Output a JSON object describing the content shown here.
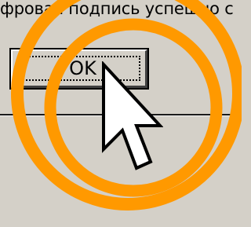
{
  "dialog": {
    "message": "фровая подпись успешно с",
    "ok_label": "OK"
  },
  "overlay": {
    "highlight_color": "#ff9900",
    "cursor_icon": "arrow-pointer-icon"
  }
}
